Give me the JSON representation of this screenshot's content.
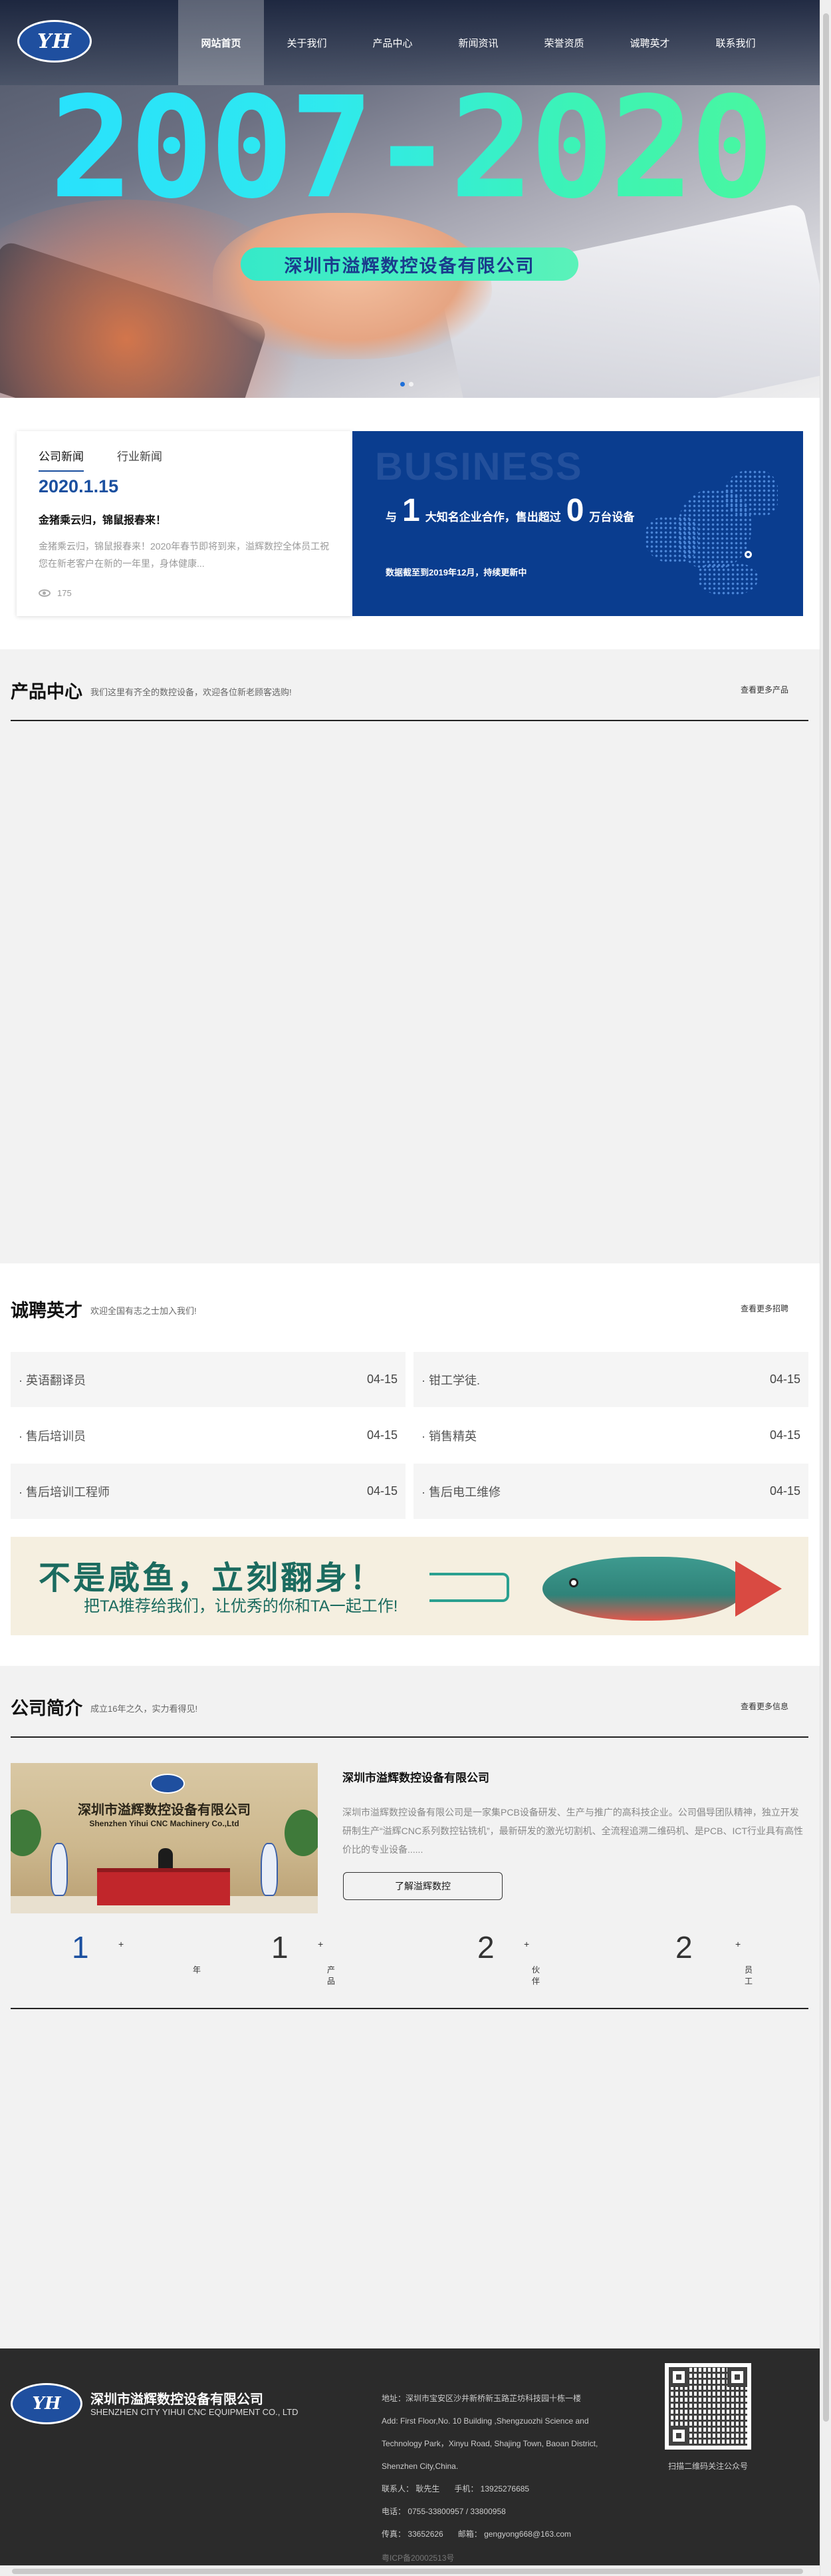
{
  "header": {
    "logo_text": "YH",
    "nav": [
      "网站首页",
      "关于我们",
      "产品中心",
      "新闻资讯",
      "荣誉资质",
      "诚聘英才",
      "联系我们"
    ],
    "active_index": 0
  },
  "banner": {
    "year_text": "2007-2020",
    "company": "深圳市溢辉数控设备有限公司",
    "slides": 2,
    "active_slide": 0
  },
  "news": {
    "tabs": [
      "公司新闻",
      "行业新闻"
    ],
    "date": "2020.1.15",
    "title": "金猪乘云归，锦鼠报春来！",
    "summary": "金猪乘云归，锦鼠报春来！2020年春节即将到来，溢辉数控全体员工祝您在新老客户在新的一年里，身体健康...",
    "views": "175"
  },
  "business": {
    "watermark": "BUSINESS",
    "prefix": "与",
    "num1": "1",
    "mid": "大知名企业合作，售出超过",
    "num2": "0",
    "suffix": "万台设备",
    "note": "数据截至到2019年12月，持续更新中"
  },
  "products": {
    "title": "产品中心",
    "subtitle": "我们这里有齐全的数控设备，欢迎各位新老顾客选购!",
    "more": "查看更多产品"
  },
  "jobs": {
    "title": "诚聘英才",
    "subtitle": "欢迎全国有志之士加入我们!",
    "more": "查看更多招聘",
    "items": [
      {
        "title": "· 英语翻译员",
        "date": "04-15"
      },
      {
        "title": "· 钳工学徒.",
        "date": "04-15"
      },
      {
        "title": "· 售后培训员",
        "date": "04-15"
      },
      {
        "title": "· 销售精英",
        "date": "04-15"
      },
      {
        "title": "· 售后培训工程师",
        "date": "04-15"
      },
      {
        "title": "· 售后电工维修",
        "date": "04-15"
      }
    ],
    "promo": {
      "line1": "不是咸鱼，立刻翻身！",
      "line2": "把TA推荐给我们，让优秀的你和TA一起工作!"
    }
  },
  "about": {
    "title": "公司简介",
    "subtitle": "成立16年之久，实力看得见!",
    "more": "查看更多信息",
    "company_name": "深圳市溢辉数控设备有限公司",
    "photo_cn": "深圳市溢辉数控设备有限公司",
    "photo_en": "Shenzhen Yihui CNC Machinery Co.,Ltd",
    "description": "深圳市溢辉数控设备有限公司是一家集PCB设备研发、生产与推广的高科技企业。公司倡导团队精神，独立开发研制生产“溢辉CNC系列数控钻铣机”，最新研发的激光切割机、全流程追溯二维码机、是PCB、ICT行业具有高性价比的专业设备......",
    "button": "了解溢辉数控",
    "stats": [
      {
        "num": "1",
        "plus": "+",
        "unit": "年"
      },
      {
        "num": "1",
        "plus": "+",
        "unit": "产品"
      },
      {
        "num": "2",
        "plus": "+",
        "unit": "伙伴"
      },
      {
        "num": "2",
        "plus": "+",
        "unit": "员工"
      }
    ]
  },
  "footer": {
    "logo_text": "YH",
    "company_cn": "深圳市溢辉数控设备有限公司",
    "company_en": "SHENZHEN CITY YIHUI CNC EQUIPMENT CO., LTD",
    "address": "地址：深圳市宝安区沙井新桥新玉路芷坊科技园十栋一楼",
    "address_en_1": "Add: First Floor,No. 10 Building ,Shengzuozhi Science and",
    "address_en_2": "Technology Park，Xinyu Road, Shajing Town, Baoan District,",
    "address_en_3": "Shenzhen City,China.",
    "contact": "联系人：  耿先生",
    "mobile": "手机：  13925276685",
    "phone": "电话：  0755-33800957 / 33800958",
    "fax": "传真：  33652626",
    "email": "邮箱：  gengyong668@163.com",
    "qr_caption": "扫描二维码关注公众号",
    "icp": "粤ICP备20002513号"
  }
}
